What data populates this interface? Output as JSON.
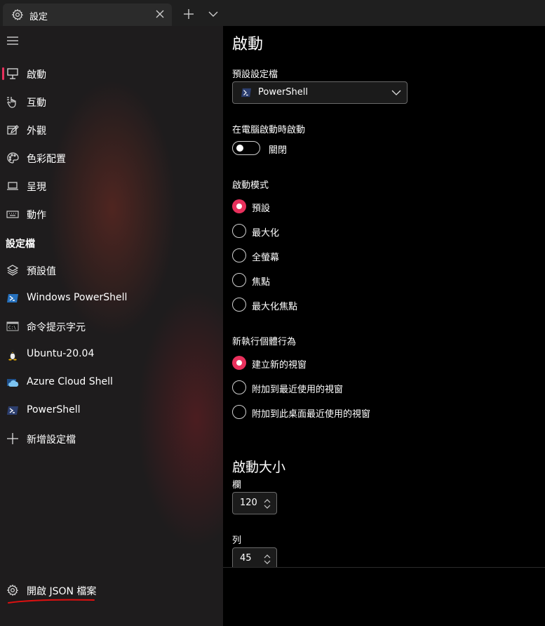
{
  "titlebar": {
    "tab_title": "設定",
    "tab_icon": "gear-icon",
    "close_icon": "close-icon",
    "new_tab_icon": "plus-icon",
    "dropdown_icon": "chevron-down-icon"
  },
  "sidebar": {
    "menu_icon": "hamburger-icon",
    "items": [
      {
        "label": "啟動",
        "icon": "monitor-icon",
        "selected": true
      },
      {
        "label": "互動",
        "icon": "hand-pointer-icon"
      },
      {
        "label": "外觀",
        "icon": "edit-window-icon"
      },
      {
        "label": "色彩配置",
        "icon": "palette-icon"
      },
      {
        "label": "呈現",
        "icon": "laptop-icon"
      },
      {
        "label": "動作",
        "icon": "keyboard-icon"
      }
    ],
    "profiles_header": "設定檔",
    "profiles": [
      {
        "label": "預設值",
        "icon": "layers-icon"
      },
      {
        "label": "Windows PowerShell",
        "icon": "powershell-icon"
      },
      {
        "label": "命令提示字元",
        "icon": "cmd-icon"
      },
      {
        "label": "Ubuntu-20.04",
        "icon": "tux-icon"
      },
      {
        "label": "Azure Cloud Shell",
        "icon": "azure-cloud-icon"
      },
      {
        "label": "PowerShell",
        "icon": "powershell-icon"
      },
      {
        "label": "新增設定檔",
        "icon": "plus-icon"
      }
    ],
    "open_json_label": "開啟 JSON 檔案"
  },
  "main": {
    "title": "啟動",
    "default_profile": {
      "label": "預設設定檔",
      "value": "PowerShell"
    },
    "launch_on_startup": {
      "label": "在電腦啟動時啟動",
      "state": "關閉"
    },
    "launch_mode": {
      "label": "啟動模式",
      "options": [
        "預設",
        "最大化",
        "全螢幕",
        "焦點",
        "最大化焦點"
      ],
      "selected": "預設"
    },
    "new_instance": {
      "label": "新執行個體行為",
      "options": [
        "建立新的視窗",
        "附加到最近使用的視窗",
        "附加到此桌面最近使用的視窗"
      ],
      "selected": "建立新的視窗"
    },
    "launch_size": {
      "heading": "啟動大小",
      "columns_label": "欄",
      "columns_value": "120",
      "rows_label": "列",
      "rows_value": "45"
    }
  },
  "colors": {
    "accent": "#e8305c",
    "sidebar_bg": "#1e1c1d",
    "titlebar_bg": "#1f1f1f"
  }
}
